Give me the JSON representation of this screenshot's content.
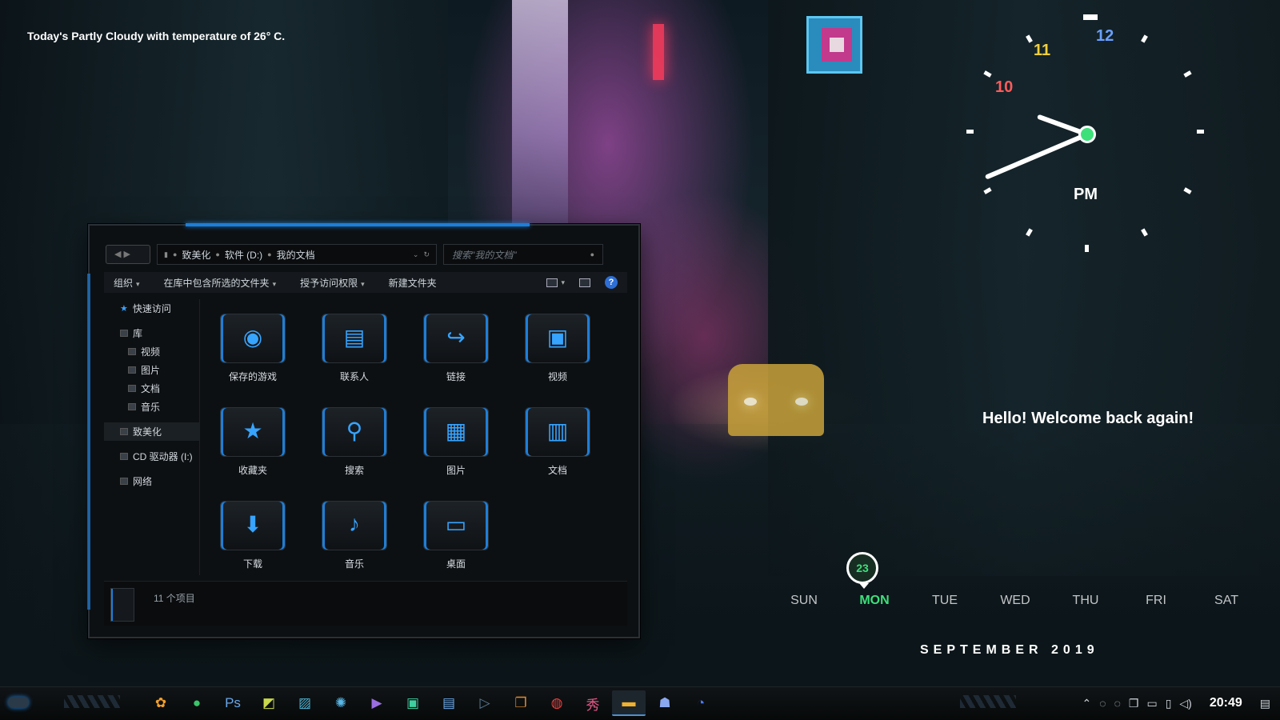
{
  "weather_text": "Today's Partly Cloudy with temperature of 26° C.",
  "clock": {
    "numbers": {
      "n12": "12",
      "n11": "11",
      "n10": "10"
    },
    "ampm": "PM",
    "hour_hand_angle_deg": 200,
    "minute_hand_angle_deg": 157
  },
  "welcome_text": "Hello! Welcome back again!",
  "calendar": {
    "days": [
      "SUN",
      "MON",
      "TUE",
      "WED",
      "THU",
      "FRI",
      "SAT"
    ],
    "active_day": "MON",
    "date": "23",
    "month_year": "SEPTEMBER 2019"
  },
  "explorer": {
    "breadcrumb": [
      "致美化",
      "软件 (D:)",
      "我的文档"
    ],
    "search_placeholder": "搜索\"我的文档\"",
    "commands": [
      "组织",
      "在库中包含所选的文件夹",
      "授予访问权限",
      "新建文件夹"
    ],
    "help": "?",
    "sidebar": [
      {
        "label": "快速访问",
        "icon": "star-icon"
      },
      {
        "label": "库",
        "icon": "library-icon"
      },
      {
        "label": "视频",
        "icon": "video-icon"
      },
      {
        "label": "图片",
        "icon": "picture-icon"
      },
      {
        "label": "文档",
        "icon": "document-icon"
      },
      {
        "label": "音乐",
        "icon": "music-icon"
      },
      {
        "label": "致美化",
        "icon": "folder-icon"
      },
      {
        "label": "CD 驱动器 (I:)",
        "icon": "cd-drive-icon"
      },
      {
        "label": "网络",
        "icon": "network-icon"
      }
    ],
    "items": [
      {
        "label": "保存的游戏",
        "icon": "gamepad-icon",
        "glyph": "◉"
      },
      {
        "label": "联系人",
        "icon": "contacts-icon",
        "glyph": "▤"
      },
      {
        "label": "链接",
        "icon": "link-arrow-icon",
        "glyph": "↪"
      },
      {
        "label": "视频",
        "icon": "video-icon",
        "glyph": "▣"
      },
      {
        "label": "收藏夹",
        "icon": "star-icon",
        "glyph": "★"
      },
      {
        "label": "搜索",
        "icon": "search-icon",
        "glyph": "⚲"
      },
      {
        "label": "图片",
        "icon": "picture-icon",
        "glyph": "▦"
      },
      {
        "label": "文档",
        "icon": "document-icon",
        "glyph": "▥"
      },
      {
        "label": "下载",
        "icon": "download-icon",
        "glyph": "⬇"
      },
      {
        "label": "音乐",
        "icon": "music-icon",
        "glyph": "♪"
      },
      {
        "label": "桌面",
        "icon": "desktop-icon",
        "glyph": "▭"
      }
    ],
    "status_text": "11 个项目"
  },
  "taskbar": {
    "apps": [
      {
        "icon": "app-orange-icon",
        "glyph": "✿",
        "color": "#f0a030"
      },
      {
        "icon": "wechat-icon",
        "glyph": "●",
        "color": "#3bc46a"
      },
      {
        "icon": "photoshop-icon",
        "glyph": "Ps",
        "color": "#6aa8e8"
      },
      {
        "icon": "illustrator-icon",
        "glyph": "◩",
        "color": "#c9d94a"
      },
      {
        "icon": "image-viewer-icon",
        "glyph": "▨",
        "color": "#4fb0d0"
      },
      {
        "icon": "palette-icon",
        "glyph": "✺",
        "color": "#5ab8e8"
      },
      {
        "icon": "visual-studio-icon",
        "glyph": "▶",
        "color": "#9a6ee0"
      },
      {
        "icon": "screen-capture-icon",
        "glyph": "▣",
        "color": "#3ecfa0"
      },
      {
        "icon": "clipboard-icon",
        "glyph": "▤",
        "color": "#6aa8e8"
      },
      {
        "icon": "terminal-icon",
        "glyph": "▷",
        "color": "#5c7c98"
      },
      {
        "icon": "window-manager-icon",
        "glyph": "❐",
        "color": "#e08a30"
      },
      {
        "icon": "netease-music-icon",
        "glyph": "◍",
        "color": "#e84040"
      },
      {
        "icon": "xiuxiu-icon",
        "glyph": "秀",
        "color": "#e85a8a"
      },
      {
        "icon": "file-explorer-icon",
        "glyph": "▬",
        "color": "#f0b030"
      },
      {
        "icon": "qq-icon",
        "glyph": "☗",
        "color": "#8aa8f0"
      },
      {
        "icon": "browser-icon",
        "glyph": "◔",
        "color": "#4a7aff"
      }
    ],
    "active_index": 13,
    "tray_icons": [
      "chevron-up-icon",
      "bell-icon",
      "bell-icon",
      "copy-icon",
      "network-icon",
      "usb-icon",
      "volume-icon"
    ],
    "time": "20:49",
    "notification_icon": "notification-icon"
  }
}
